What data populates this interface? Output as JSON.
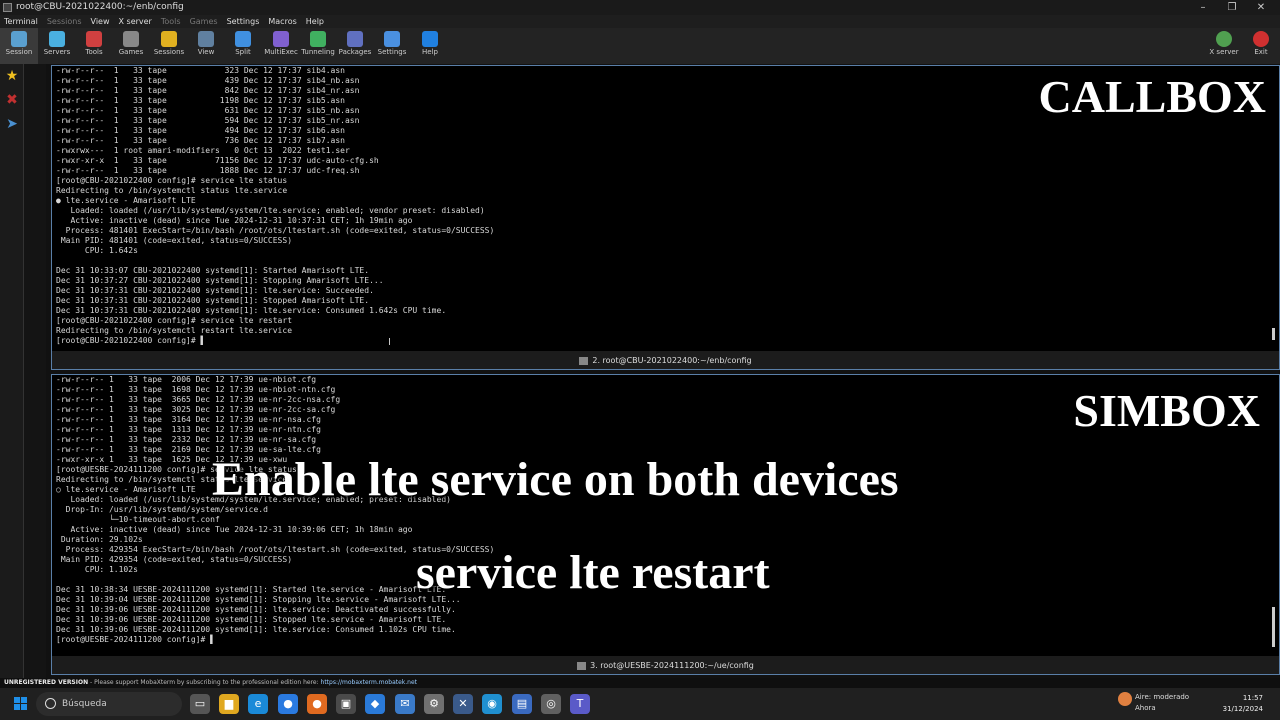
{
  "window": {
    "title": "root@CBU-2021022400:~/enb/config"
  },
  "menu": [
    "Terminal",
    "Sessions",
    "View",
    "X server",
    "Tools",
    "Games",
    "Settings",
    "Macros",
    "Help"
  ],
  "toolbar": [
    {
      "label": "Session",
      "icon": "session-icon",
      "color": "#5aa0d0"
    },
    {
      "label": "Servers",
      "icon": "servers-icon",
      "color": "#4ab0e0"
    },
    {
      "label": "Tools",
      "icon": "tools-icon",
      "color": "#d04040"
    },
    {
      "label": "Games",
      "icon": "games-icon",
      "color": "#888888"
    },
    {
      "label": "Sessions",
      "icon": "star-icon",
      "color": "#e0b020"
    },
    {
      "label": "View",
      "icon": "view-icon",
      "color": "#6080a0"
    },
    {
      "label": "Split",
      "icon": "split-icon",
      "color": "#4090e0"
    },
    {
      "label": "MultiExec",
      "icon": "multiexec-icon",
      "color": "#8060d0"
    },
    {
      "label": "Tunneling",
      "icon": "tunneling-icon",
      "color": "#40b060"
    },
    {
      "label": "Packages",
      "icon": "packages-icon",
      "color": "#6070c0"
    },
    {
      "label": "Settings",
      "icon": "settings-icon",
      "color": "#4a90e0"
    },
    {
      "label": "Help",
      "icon": "help-icon",
      "color": "#2080e0"
    }
  ],
  "toolbar_right": [
    {
      "label": "X server",
      "icon": "x-server-icon",
      "color": "#50a050"
    },
    {
      "label": "Exit",
      "icon": "power-icon",
      "color": "#d03030"
    }
  ],
  "pane1": {
    "tab_label": "2. root@CBU-2021022400:~/enb/config",
    "lines": [
      "-rw-r--r--  1   33 tape            323 Dec 12 17:37 sib4.asn",
      "-rw-r--r--  1   33 tape            439 Dec 12 17:37 sib4_nb.asn",
      "-rw-r--r--  1   33 tape            842 Dec 12 17:37 sib4_nr.asn",
      "-rw-r--r--  1   33 tape           1198 Dec 12 17:37 sib5.asn",
      "-rw-r--r--  1   33 tape            631 Dec 12 17:37 sib5_nb.asn",
      "-rw-r--r--  1   33 tape            594 Dec 12 17:37 sib5_nr.asn",
      "-rw-r--r--  1   33 tape            494 Dec 12 17:37 sib6.asn",
      "-rw-r--r--  1   33 tape            736 Dec 12 17:37 sib7.asn",
      "-rwxrwx---  1 root amari-modifiers   0 Oct 13  2022 test1.ser",
      "-rwxr-xr-x  1   33 tape          71156 Dec 12 17:37 udc-auto-cfg.sh",
      "-rw-r--r--  1   33 tape           1888 Dec 12 17:37 udc-freq.sh",
      "[root@CBU-2021022400 config]# service lte status",
      "Redirecting to /bin/systemctl status lte.service",
      "● lte.service - Amarisoft LTE",
      "   Loaded: loaded (/usr/lib/systemd/system/lte.service; enabled; vendor preset: disabled)",
      "   Active: inactive (dead) since Tue 2024-12-31 10:37:31 CET; 1h 19min ago",
      "  Process: 481401 ExecStart=/bin/bash /root/ots/ltestart.sh (code=exited, status=0/SUCCESS)",
      " Main PID: 481401 (code=exited, status=0/SUCCESS)",
      "      CPU: 1.642s",
      "",
      "Dec 31 10:33:07 CBU-2021022400 systemd[1]: Started Amarisoft LTE.",
      "Dec 31 10:37:27 CBU-2021022400 systemd[1]: Stopping Amarisoft LTE...",
      "Dec 31 10:37:31 CBU-2021022400 systemd[1]: lte.service: Succeeded.",
      "Dec 31 10:37:31 CBU-2021022400 systemd[1]: Stopped Amarisoft LTE.",
      "Dec 31 10:37:31 CBU-2021022400 systemd[1]: lte.service: Consumed 1.642s CPU time.",
      "[root@CBU-2021022400 config]# service lte restart",
      "Redirecting to /bin/systemctl restart lte.service",
      "[root@CBU-2021022400 config]# ▌"
    ]
  },
  "pane2": {
    "tab_label": "3. root@UESBE-2024111200:~/ue/config",
    "lines": [
      "-rw-r--r-- 1   33 tape  2006 Dec 12 17:39 ue-nbiot.cfg",
      "-rw-r--r-- 1   33 tape  1698 Dec 12 17:39 ue-nbiot-ntn.cfg",
      "-rw-r--r-- 1   33 tape  3665 Dec 12 17:39 ue-nr-2cc-nsa.cfg",
      "-rw-r--r-- 1   33 tape  3025 Dec 12 17:39 ue-nr-2cc-sa.cfg",
      "-rw-r--r-- 1   33 tape  3164 Dec 12 17:39 ue-nr-nsa.cfg",
      "-rw-r--r-- 1   33 tape  1313 Dec 12 17:39 ue-nr-ntn.cfg",
      "-rw-r--r-- 1   33 tape  2332 Dec 12 17:39 ue-nr-sa.cfg",
      "-rw-r--r-- 1   33 tape  2169 Dec 12 17:39 ue-sa-lte.cfg",
      "-rwxr-xr-x 1   33 tape  1625 Dec 12 17:39 ue-xwu",
      "[root@UESBE-2024111200 config]# service lte status",
      "Redirecting to /bin/systemctl status lte.service",
      "○ lte.service - Amarisoft LTE",
      "   Loaded: loaded (/usr/lib/systemd/system/lte.service; enabled; preset: disabled)",
      "  Drop-In: /usr/lib/systemd/system/service.d",
      "           └─10-timeout-abort.conf",
      "   Active: inactive (dead) since Tue 2024-12-31 10:39:06 CET; 1h 18min ago",
      " Duration: 29.102s",
      "  Process: 429354 ExecStart=/bin/bash /root/ots/ltestart.sh (code=exited, status=0/SUCCESS)",
      " Main PID: 429354 (code=exited, status=0/SUCCESS)",
      "      CPU: 1.102s",
      "",
      "Dec 31 10:38:34 UESBE-2024111200 systemd[1]: Started lte.service - Amarisoft LTE.",
      "Dec 31 10:39:04 UESBE-2024111200 systemd[1]: Stopping lte.service - Amarisoft LTE...",
      "Dec 31 10:39:06 UESBE-2024111200 systemd[1]: lte.service: Deactivated successfully.",
      "Dec 31 10:39:06 UESBE-2024111200 systemd[1]: Stopped lte.service - Amarisoft LTE.",
      "Dec 31 10:39:06 UESBE-2024111200 systemd[1]: lte.service: Consumed 1.102s CPU time.",
      "[root@UESBE-2024111200 config]# ▌"
    ]
  },
  "overlay": {
    "callbox": "CALLBOX",
    "simbox": "SIMBOX",
    "caption_main": "Enable lte service on both devices",
    "caption_cmd": "service lte restart"
  },
  "statusbar": {
    "label": "UNREGISTERED VERSION",
    "message": "  -  Please support MobaXterm by subscribing to the professional edition here: ",
    "url": "https://mobaxterm.mobatek.net"
  },
  "taskbar": {
    "search_placeholder": "Búsqueda",
    "apps": [
      {
        "icon": "task-view-icon",
        "color": "#555555",
        "glyph": "▭"
      },
      {
        "icon": "file-explorer-icon",
        "color": "#e0a820",
        "glyph": "▆"
      },
      {
        "icon": "edge-icon",
        "color": "#1a8ad8",
        "glyph": "e"
      },
      {
        "icon": "chrome-icon",
        "color": "#2a7ae0",
        "glyph": "●"
      },
      {
        "icon": "firefox-icon",
        "color": "#e06a20",
        "glyph": "●"
      },
      {
        "icon": "mobaxterm-icon",
        "color": "#4a4a4a",
        "glyph": "▣"
      },
      {
        "icon": "vscode-icon",
        "color": "#2a7ad8",
        "glyph": "◆"
      },
      {
        "icon": "mail-icon",
        "color": "#3a7ac8",
        "glyph": "✉"
      },
      {
        "icon": "settings-app-icon",
        "color": "#707070",
        "glyph": "⚙"
      },
      {
        "icon": "app-icon",
        "color": "#3a5a8a",
        "glyph": "✕"
      },
      {
        "icon": "browser-icon",
        "color": "#2090d0",
        "glyph": "◉"
      },
      {
        "icon": "notes-icon",
        "color": "#3a6ac0",
        "glyph": "▤"
      },
      {
        "icon": "chrome-alt-icon",
        "color": "#606060",
        "glyph": "◎"
      },
      {
        "icon": "teams-icon",
        "color": "#5a5ac8",
        "glyph": "T"
      }
    ],
    "weather_line1": "Aire: moderado",
    "weather_line2": "Ahora",
    "time": "11:57",
    "date": "31/12/2024"
  }
}
